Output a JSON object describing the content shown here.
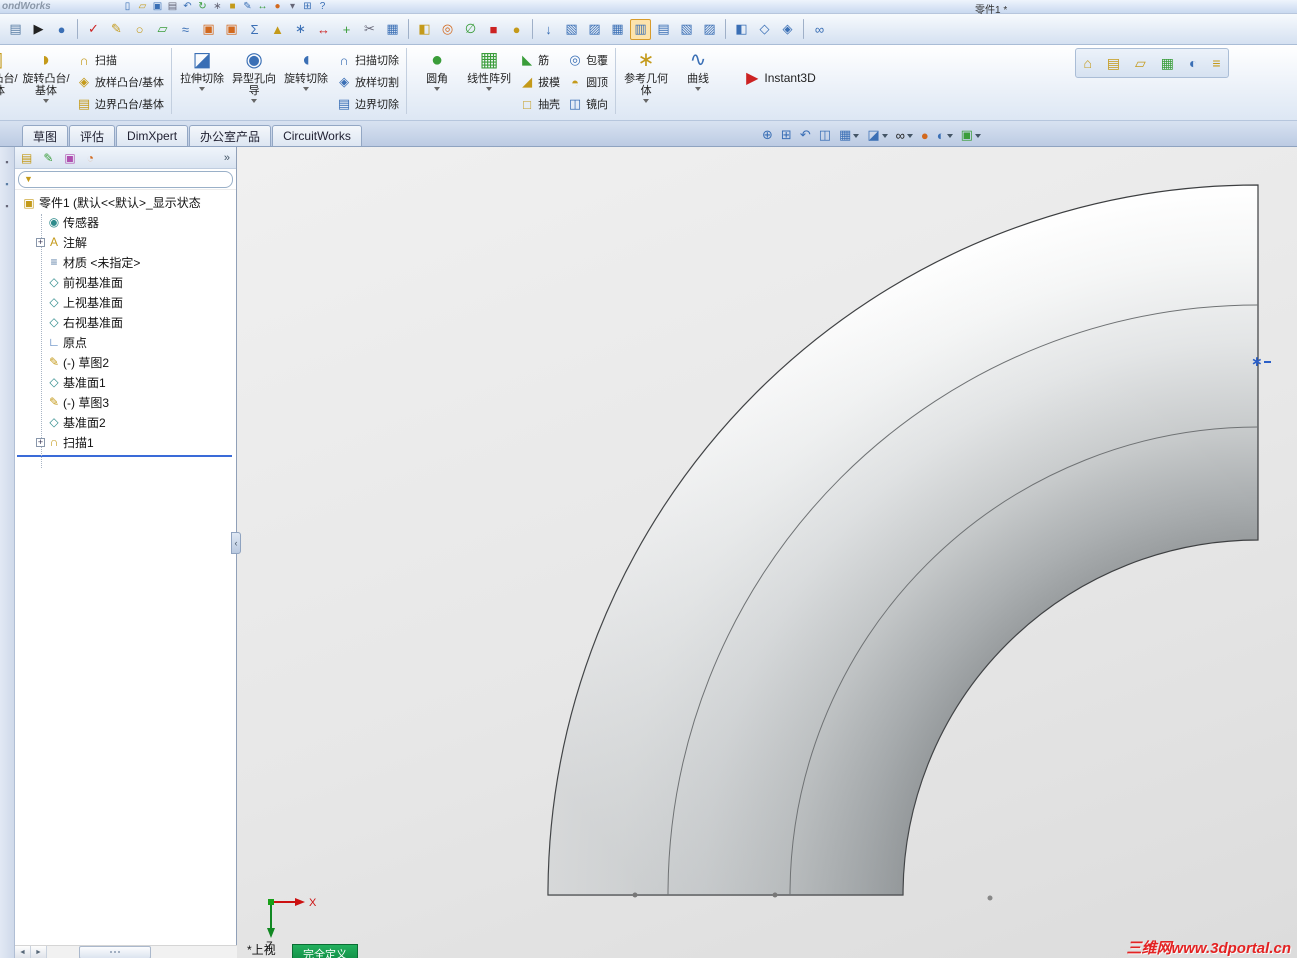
{
  "colors": {
    "accent_blue": "#2b5fc7",
    "chrome_blue": "#d6e2f3",
    "status_green": "#0f8a42",
    "watermark_red": "#e32222",
    "viewport_gray": "#e8e8e8",
    "rollback_blue": "#3a6bd8",
    "gold": "#c49a1a",
    "feature_blue": "#3a6fb5",
    "feature_green": "#3a9d3a"
  },
  "titlebar": {
    "logo": "ondWorks",
    "doc_title": "零件1 *"
  },
  "menubar": {
    "icons": [
      {
        "name": "new-document-icon",
        "glyph": "▯",
        "cls": "c-blue"
      },
      {
        "name": "open-icon",
        "glyph": "▱",
        "cls": "c-gold"
      },
      {
        "name": "save-icon",
        "glyph": "▣",
        "cls": "c-blue"
      },
      {
        "name": "print-icon",
        "glyph": "▤",
        "cls": "c-gray"
      },
      {
        "name": "undo-icon",
        "glyph": "↶",
        "cls": "c-blue"
      },
      {
        "name": "rebuild-icon",
        "glyph": "↻",
        "cls": "c-green"
      },
      {
        "name": "options-icon",
        "glyph": "∗",
        "cls": "c-gray"
      },
      {
        "name": "color-swatch-icon",
        "glyph": "■",
        "cls": "c-gold"
      },
      {
        "name": "sketch-mini-icon",
        "glyph": "✎",
        "cls": "c-blue"
      },
      {
        "name": "dimension-mini-icon",
        "glyph": "↔",
        "cls": "c-green"
      },
      {
        "name": "appearance-mini-icon",
        "glyph": "●",
        "cls": "c-orange"
      },
      {
        "name": "dropdown-caret-icon",
        "glyph": "▾",
        "cls": "c-gray"
      },
      {
        "name": "grid-icon",
        "glyph": "⊞",
        "cls": "c-blue"
      },
      {
        "name": "help-icon",
        "glyph": "?",
        "cls": "c-blue"
      }
    ]
  },
  "toolbar": {
    "icons": [
      {
        "name": "document-properties-icon",
        "glyph": "▤",
        "cls": "c-slate"
      },
      {
        "name": "select-pointer-icon",
        "glyph": "▶",
        "cls": "c-dark"
      },
      {
        "name": "appearance-sphere-icon",
        "glyph": "●",
        "cls": "c-blue"
      },
      {
        "name": "toolbar-separator",
        "glyph": "",
        "cls": "sep"
      },
      {
        "name": "spell-check-icon",
        "glyph": "✓",
        "cls": "c-red"
      },
      {
        "name": "note-icon",
        "glyph": "✎",
        "cls": "c-gold"
      },
      {
        "name": "balloon-icon",
        "glyph": "○",
        "cls": "c-gold"
      },
      {
        "name": "datum-target-icon",
        "glyph": "▱",
        "cls": "c-green"
      },
      {
        "name": "weld-symbol-icon",
        "glyph": "≈",
        "cls": "c-blue"
      },
      {
        "name": "datum-check-icon",
        "glyph": "▣",
        "cls": "c-orange"
      },
      {
        "name": "tolerance-check-icon",
        "glyph": "▣",
        "cls": "c-orange"
      },
      {
        "name": "equations-icon",
        "glyph": "Σ",
        "cls": "c-blue"
      },
      {
        "name": "warning-triangle-icon",
        "glyph": "▲",
        "cls": "c-gold"
      },
      {
        "name": "centerline-icon",
        "glyph": "∗",
        "cls": "c-blue"
      },
      {
        "name": "measure-icon",
        "glyph": "↔",
        "cls": "c-red"
      },
      {
        "name": "add-relation-icon",
        "glyph": "+",
        "cls": "c-green"
      },
      {
        "name": "trim-icon",
        "glyph": "✂",
        "cls": "c-gray"
      },
      {
        "name": "table-icon",
        "glyph": "▦",
        "cls": "c-blue"
      },
      {
        "name": "toolbar-separator",
        "glyph": "",
        "cls": "sep"
      },
      {
        "name": "insert-part-icon",
        "glyph": "◧",
        "cls": "c-gold"
      },
      {
        "name": "circle-tool-icon",
        "glyph": "◎",
        "cls": "c-orange"
      },
      {
        "name": "no-preview-icon",
        "glyph": "∅",
        "cls": "c-green"
      },
      {
        "name": "stop-icon",
        "glyph": "■",
        "cls": "c-red"
      },
      {
        "name": "render-sphere-icon",
        "glyph": "●",
        "cls": "c-gold"
      },
      {
        "name": "toolbar-separator",
        "glyph": "",
        "cls": "sep"
      },
      {
        "name": "import-icon",
        "glyph": "↓",
        "cls": "c-blue"
      },
      {
        "name": "view-front-icon",
        "glyph": "▧",
        "cls": "c-blue"
      },
      {
        "name": "view-back-icon",
        "glyph": "▨",
        "cls": "c-blue"
      },
      {
        "name": "view-left-icon",
        "glyph": "▦",
        "cls": "c-blue"
      },
      {
        "name": "view-right-icon",
        "glyph": "▥",
        "cls": "c-blue pressed"
      },
      {
        "name": "view-top-icon",
        "glyph": "▤",
        "cls": "c-blue"
      },
      {
        "name": "view-bottom-icon",
        "glyph": "▧",
        "cls": "c-blue"
      },
      {
        "name": "view-isometric-icon",
        "glyph": "▨",
        "cls": "c-blue"
      },
      {
        "name": "toolbar-separator",
        "glyph": "",
        "cls": "sep"
      },
      {
        "name": "shaded-view-icon",
        "glyph": "◧",
        "cls": "c-blue"
      },
      {
        "name": "hidden-lines-icon",
        "glyph": "◇",
        "cls": "c-blue"
      },
      {
        "name": "wireframe-icon",
        "glyph": "◈",
        "cls": "c-blue"
      },
      {
        "name": "toolbar-separator",
        "glyph": "",
        "cls": "sep"
      },
      {
        "name": "link-icon",
        "glyph": "∞",
        "cls": "c-blue"
      }
    ]
  },
  "ribbon": {
    "big": [
      {
        "label": "拉伸凸台/基体",
        "glyph": "◧"
      },
      {
        "label": "旋转凸台/基体",
        "glyph": "◗"
      },
      {
        "label": "拉伸切除",
        "glyph": "◪"
      },
      {
        "label": "异型孔向导",
        "glyph": "◉"
      },
      {
        "label": "旋转切除",
        "glyph": "◖"
      },
      {
        "label": "圆角",
        "glyph": "●"
      },
      {
        "label": "线性阵列",
        "glyph": "▦"
      },
      {
        "label": "参考几何体",
        "glyph": "∗"
      },
      {
        "label": "曲线",
        "glyph": "∿"
      }
    ],
    "stackA": [
      {
        "label": "扫描",
        "glyph": "∩",
        "cls": "c-gold",
        "name": "sweep-button"
      },
      {
        "label": "放样凸台/基体",
        "glyph": "◈",
        "cls": "c-gold",
        "name": "loft-boss-button"
      },
      {
        "label": "边界凸台/基体",
        "glyph": "▤",
        "cls": "c-gold",
        "name": "boundary-boss-button"
      }
    ],
    "stackB": [
      {
        "label": "扫描切除",
        "glyph": "∩",
        "cls": "c-blue",
        "name": "swept-cut-button"
      },
      {
        "label": "放样切割",
        "glyph": "◈",
        "cls": "c-blue",
        "name": "lofted-cut-button"
      },
      {
        "label": "边界切除",
        "glyph": "▤",
        "cls": "c-blue",
        "name": "boundary-cut-button"
      }
    ],
    "stackC": [
      {
        "label": "筋",
        "glyph": "◣",
        "cls": "c-green",
        "name": "rib-button"
      },
      {
        "label": "拔模",
        "glyph": "◢",
        "cls": "c-gold",
        "name": "draft-button"
      },
      {
        "label": "抽壳",
        "glyph": "□",
        "cls": "c-gold",
        "name": "shell-button"
      }
    ],
    "stackD": [
      {
        "label": "包覆",
        "glyph": "◎",
        "cls": "c-blue",
        "name": "wrap-button"
      },
      {
        "label": "圆顶",
        "glyph": "◓",
        "cls": "c-gold",
        "name": "dome-button"
      },
      {
        "label": "镜向",
        "glyph": "◫",
        "cls": "c-blue",
        "name": "mirror-button"
      }
    ],
    "instant3d": {
      "label": "Instant3D",
      "glyph": "▶"
    }
  },
  "tabs": [
    {
      "label": "草图",
      "name": "tab-sketch"
    },
    {
      "label": "评估",
      "name": "tab-evaluate"
    },
    {
      "label": "DimXpert",
      "name": "tab-dimxpert"
    },
    {
      "label": "办公室产品",
      "name": "tab-office-products"
    },
    {
      "label": "CircuitWorks",
      "name": "tab-circuitworks"
    }
  ],
  "headsup": {
    "icons": [
      {
        "name": "zoom-fit-icon",
        "glyph": "⊕",
        "cls": "c-blue"
      },
      {
        "name": "zoom-area-icon",
        "glyph": "⊞",
        "cls": "c-blue"
      },
      {
        "name": "previous-view-icon",
        "glyph": "↶",
        "cls": "c-blue"
      },
      {
        "name": "section-view-icon",
        "glyph": "◫",
        "cls": "c-blue"
      },
      {
        "name": "view-orientation-icon",
        "glyph": "▦",
        "cls": "c-blue withcaret"
      },
      {
        "name": "display-style-icon",
        "glyph": "◪",
        "cls": "c-blue withcaret"
      },
      {
        "name": "hide-show-items-icon",
        "glyph": "∞",
        "cls": "c-dark withcaret"
      },
      {
        "name": "edit-appearance-icon",
        "glyph": "●",
        "cls": "c-orange"
      },
      {
        "name": "apply-scene-icon",
        "glyph": "◐",
        "cls": "c-blue withcaret"
      },
      {
        "name": "view-settings-icon",
        "glyph": "▣",
        "cls": "c-green withcaret"
      }
    ]
  },
  "taskpane": {
    "icons": [
      {
        "name": "solidworks-resources-icon",
        "glyph": "⌂",
        "cls": "c-gold"
      },
      {
        "name": "design-library-icon",
        "glyph": "▤",
        "cls": "c-gold"
      },
      {
        "name": "file-explorer-icon",
        "glyph": "▱",
        "cls": "c-gold"
      },
      {
        "name": "view-palette-icon",
        "glyph": "▦",
        "cls": "c-green"
      },
      {
        "name": "appearances-scenes-icon",
        "glyph": "◐",
        "cls": "c-blue"
      },
      {
        "name": "custom-properties-icon",
        "glyph": "≡",
        "cls": "c-gold"
      }
    ]
  },
  "panel": {
    "tabs": [
      {
        "name": "featuremanager-tab-icon",
        "glyph": "▤",
        "cls": "c-gold"
      },
      {
        "name": "propertymanager-tab-icon",
        "glyph": "✎",
        "cls": "c-green"
      },
      {
        "name": "configurations-tab-icon",
        "glyph": "▣",
        "cls": "c-pink"
      },
      {
        "name": "displaymanager-tab-icon",
        "glyph": "◔",
        "cls": "c-orange"
      }
    ],
    "chevron": "»",
    "filter_funnel": "▼",
    "filter_placeholder": "",
    "scroll_left": "◄",
    "scroll_right": "►"
  },
  "leftstrip": {
    "icons": [
      {
        "name": "quick-snaps-icon",
        "glyph": "▪",
        "cls": "c-gray"
      },
      {
        "name": "selection-filter-icon",
        "glyph": "▪",
        "cls": "c-slate"
      },
      {
        "name": "toolbar-handle-icon",
        "glyph": "▪",
        "cls": "c-gray"
      }
    ]
  },
  "tree": {
    "root": {
      "label": "零件1 (默认<<默认>_显示状态",
      "glyph": "▣"
    },
    "items": [
      {
        "expand": "",
        "glyph": "◉",
        "cls": "c-teal",
        "label": "传感器",
        "name": "tree-item-sensors"
      },
      {
        "expand": "+",
        "glyph": "A",
        "cls": "c-gold",
        "label": "注解",
        "name": "tree-item-annotations"
      },
      {
        "expand": "",
        "glyph": "≡",
        "cls": "c-slate",
        "label": "材质 <未指定>",
        "name": "tree-item-material"
      },
      {
        "expand": "",
        "glyph": "◇",
        "cls": "c-teal",
        "label": "前视基准面",
        "name": "tree-item-front-plane"
      },
      {
        "expand": "",
        "glyph": "◇",
        "cls": "c-teal",
        "label": "上视基准面",
        "name": "tree-item-top-plane"
      },
      {
        "expand": "",
        "glyph": "◇",
        "cls": "c-teal",
        "label": "右视基准面",
        "name": "tree-item-right-plane"
      },
      {
        "expand": "",
        "glyph": "∟",
        "cls": "c-blue",
        "label": "原点",
        "name": "tree-item-origin"
      },
      {
        "expand": "",
        "glyph": "✎",
        "cls": "c-gold",
        "label": "(-) 草图2",
        "name": "tree-item-sketch2"
      },
      {
        "expand": "",
        "glyph": "◇",
        "cls": "c-teal",
        "label": "基准面1",
        "name": "tree-item-plane1"
      },
      {
        "expand": "",
        "glyph": "✎",
        "cls": "c-gold",
        "label": "(-) 草图3",
        "name": "tree-item-sketch3"
      },
      {
        "expand": "",
        "glyph": "◇",
        "cls": "c-teal",
        "label": "基准面2",
        "name": "tree-item-plane2"
      },
      {
        "expand": "+",
        "glyph": "∩",
        "cls": "c-gold",
        "label": "扫描1",
        "name": "tree-item-sweep1"
      }
    ]
  },
  "viewport": {
    "view_label": "*上视",
    "status_badge": "完全定义",
    "axis_x": "X",
    "axis_z": "Z",
    "selection_marker": "∗",
    "watermark": "三维网www.3dportal.cn"
  }
}
